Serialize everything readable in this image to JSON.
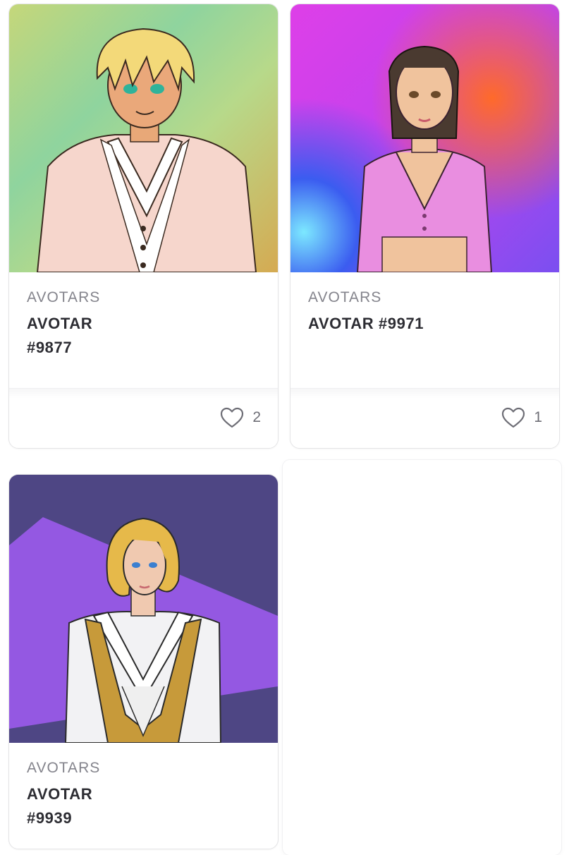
{
  "cards": [
    {
      "collection": "AVOTARS",
      "name_line1": "AVOTAR",
      "name_line2": "#9877",
      "likes": "2",
      "background": [
        "#b6d98a",
        "#8fd19a",
        "#d9b35f"
      ]
    },
    {
      "collection": "AVOTARS",
      "name_line1": "AVOTAR #9971",
      "name_line2": "",
      "likes": "1",
      "background": [
        "#e044e6",
        "#ff6a3a",
        "#6b4df0"
      ]
    },
    {
      "collection": "AVOTARS",
      "name_line1": "AVOTAR",
      "name_line2": "#9939",
      "likes": "",
      "background": [
        "#8f57e0",
        "#4a4a8a"
      ]
    }
  ],
  "icons": {
    "like": "heart-outline-icon"
  },
  "colors": {
    "label_gray": "#84848c",
    "title_dark": "#2d2d33",
    "border": "#e4e4e6"
  }
}
